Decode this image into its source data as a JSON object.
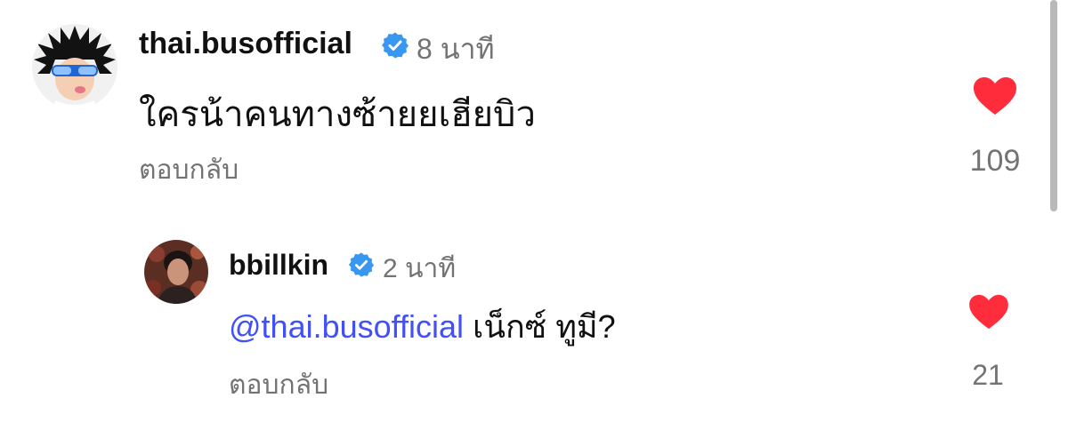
{
  "comments": [
    {
      "username": "thai.busofficial",
      "verified": true,
      "time": "8 นาที",
      "text": "ใครน้าคนทางซ้ายยเฮียบิว",
      "reply_label": "ตอบกลับ",
      "likes": "109",
      "liked": true,
      "avatar_icon": "spiky-hair-kid-avatar"
    },
    {
      "username": "bbillkin",
      "verified": true,
      "time": "2 นาที",
      "mention": "@thai.busofficial",
      "text": "เน็กซ์ ทูมี?",
      "reply_label": "ตอบกลับ",
      "likes": "21",
      "liked": true,
      "avatar_icon": "person-portrait-avatar"
    }
  ],
  "colors": {
    "like": "#ff2d3b",
    "verified": "#3897f0",
    "mention": "#4150f7",
    "muted": "#737373"
  }
}
